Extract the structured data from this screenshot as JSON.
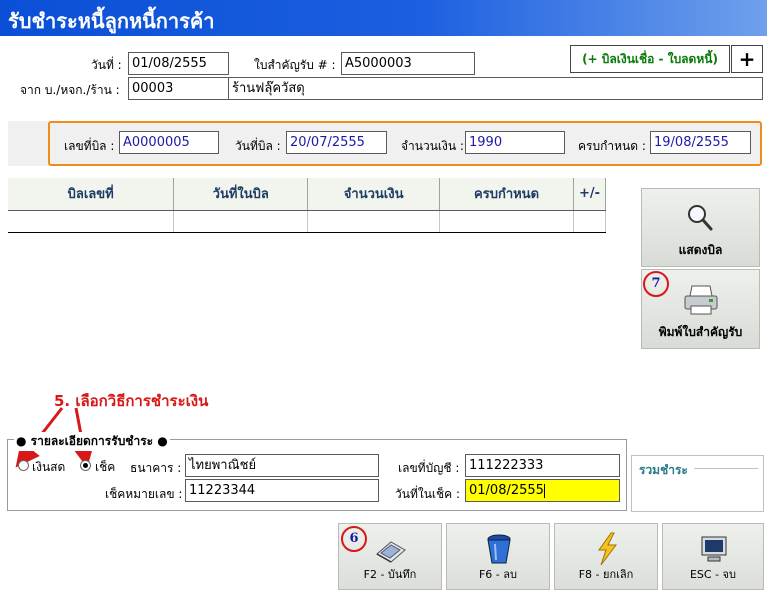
{
  "window": {
    "title": "รับชำระหนี้ลูกหนี้การค้า"
  },
  "header": {
    "date_label": "วันที่ :",
    "date_value": "01/08/2555",
    "receipt_label": "ใบสำคัญรับ # :",
    "receipt_value": "A5000003",
    "from_label": "จาก บ./หจก./ร้าน :",
    "customer_code": "00003",
    "customer_name": "ร้านฟลุ๊ควัสดุ",
    "add_credit_bill_label": "(+ บิลเงินเชื่อ - ใบลดหนี้)",
    "plus_label": "+"
  },
  "bill": {
    "bill_no_label": "เลขที่บิล :",
    "bill_no_value": "A0000005",
    "bill_date_label": "วันที่บิล :",
    "bill_date_value": "20/07/2555",
    "amount_label": "จำนวนเงิน :",
    "amount_value": "1990",
    "due_label": "ครบกำหนด :",
    "due_value": "19/08/2555"
  },
  "grid": {
    "columns": [
      "บิลเลขที่",
      "วันที่ในบิล",
      "จำนวนเงิน",
      "ครบกำหนด",
      "+/-"
    ],
    "rows": [
      [
        "",
        "",
        "",
        "",
        ""
      ]
    ]
  },
  "side_buttons": {
    "show_bill": "แสดงบิล",
    "print_receipt": "พิมพ์ใบสำคัญรับ"
  },
  "annotations": {
    "step5": "5. เลือกวิธีการชำระเงิน",
    "step6": "6",
    "step7": "7"
  },
  "payment": {
    "group_label": "● รายละเอียดการรับชำระ ●",
    "cash_label": "เงินสด",
    "check_label": "เช็ค",
    "selected": "check",
    "bank_label": "ธนาคาร :",
    "bank_value": "ไทยพาณิชย์",
    "account_label": "เลขที่บัญชี :",
    "account_value": "111222333",
    "check_no_label": "เช็คหมายเลข :",
    "check_no_value": "11223344",
    "check_date_label": "วันที่ในเช็ค :",
    "check_date_value": "01/08/2555"
  },
  "summary": {
    "label": "รวมชำระ"
  },
  "footer": {
    "save": "F2 - บันทึก",
    "delete": "F6 - ลบ",
    "cancel": "F8 - ยกเลิก",
    "exit": "ESC - จบ"
  },
  "colors": {
    "title_bar": "#0a4fd6",
    "highlight_border": "#f08c1a",
    "annotation_red": "#d81818",
    "active_field": "#ffff00",
    "value_blue": "#1a1aa8"
  }
}
